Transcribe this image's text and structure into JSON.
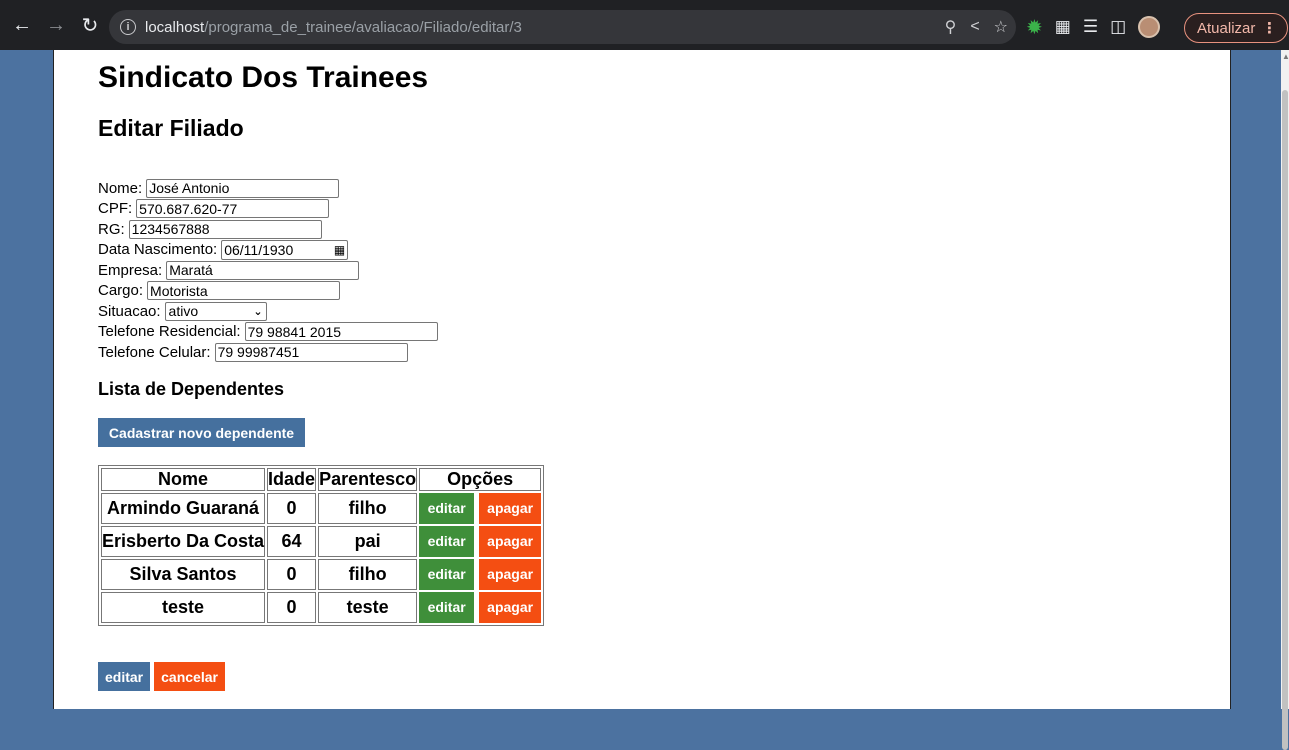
{
  "browser": {
    "url_host": "localhost",
    "url_path": "/programa_de_trainee/avaliacao/Filiado/editar/3",
    "update_label": "Atualizar"
  },
  "page": {
    "title": "Sindicato Dos Trainees",
    "subtitle": "Editar Filiado"
  },
  "form": {
    "nome": {
      "label": "Nome:",
      "value": "José Antonio"
    },
    "cpf": {
      "label": "CPF:",
      "value": "570.687.620-77"
    },
    "rg": {
      "label": "RG:",
      "value": "1234567888"
    },
    "data_nascimento": {
      "label": "Data Nascimento:",
      "value": "06/11/1930"
    },
    "empresa": {
      "label": "Empresa:",
      "value": "Maratá"
    },
    "cargo": {
      "label": "Cargo:",
      "value": "Motorista"
    },
    "situacao": {
      "label": "Situacao:",
      "value": "ativo"
    },
    "telefone_residencial": {
      "label": "Telefone Residencial:",
      "value": "79 98841 2015"
    },
    "telefone_celular": {
      "label": "Telefone Celular:",
      "value": "79 99987451"
    }
  },
  "dependentes": {
    "heading": "Lista de Dependentes",
    "new_button": "Cadastrar novo dependente",
    "columns": [
      "Nome",
      "Idade",
      "Parentesco",
      "Opções"
    ],
    "rows": [
      {
        "nome": "Armindo Guaraná",
        "idade": "0",
        "parentesco": "filho"
      },
      {
        "nome": "Erisberto Da Costa",
        "idade": "64",
        "parentesco": "pai"
      },
      {
        "nome": "Silva Santos",
        "idade": "0",
        "parentesco": "filho"
      },
      {
        "nome": "teste",
        "idade": "0",
        "parentesco": "teste"
      }
    ],
    "edit_label": "editar",
    "delete_label": "apagar"
  },
  "actions": {
    "edit_label": "editar",
    "cancel_label": "cancelar"
  },
  "colors": {
    "primary": "#45709e",
    "success": "#3f8f3a",
    "danger": "#f44e12",
    "background": "#4c72a0"
  }
}
